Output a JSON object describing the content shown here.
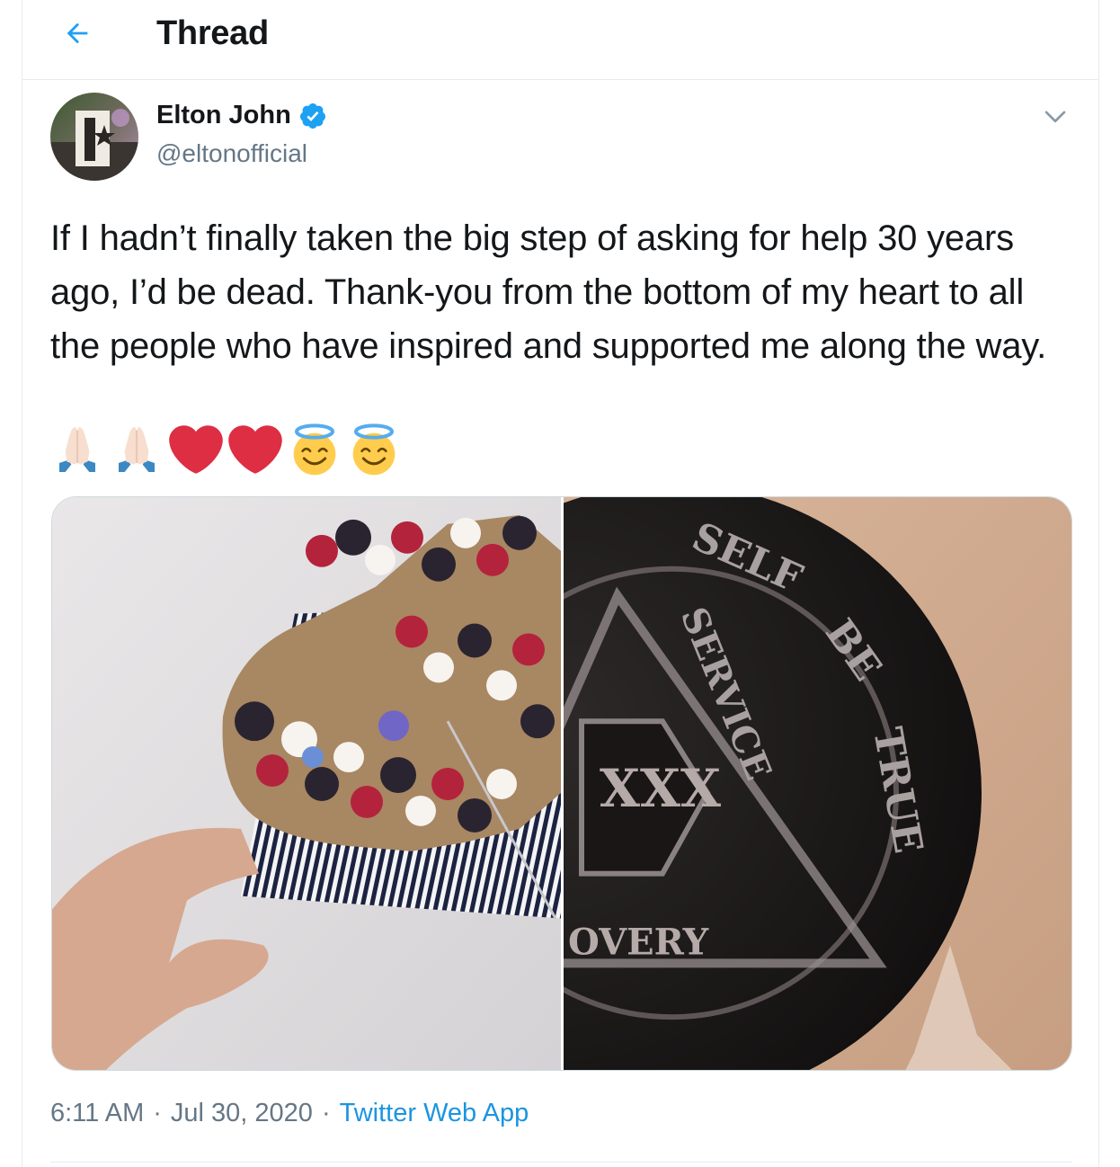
{
  "header": {
    "title": "Thread",
    "back_icon": "arrow-left-icon"
  },
  "tweet": {
    "author": {
      "display_name": "Elton John",
      "handle": "@eltonofficial",
      "verified": true
    },
    "text": "If I hadn’t finally taken the big step of asking for help 30 years ago, I’d be dead. Thank-you from the bottom of my heart to all the people who have inspired and supported me along the way.",
    "emojis": [
      "folded-hands",
      "folded-hands",
      "red-heart",
      "red-heart",
      "smiling-face-with-halo",
      "smiling-face-with-halo"
    ],
    "media": [
      {
        "description": "photo-cake"
      },
      {
        "description": "photo-medallion",
        "medallion_text": [
          "SELF",
          "BE",
          "TRUE",
          "SERVICE",
          "XXX",
          "OVERY"
        ]
      }
    ],
    "meta": {
      "time": "6:11 AM",
      "separator": "·",
      "date": "Jul 30, 2020",
      "source": "Twitter Web App"
    }
  },
  "colors": {
    "accent": "#1da1f2",
    "link": "#1b95e0",
    "secondary": "#657786",
    "heart": "#dd2e44",
    "border": "#e6ecf0"
  }
}
